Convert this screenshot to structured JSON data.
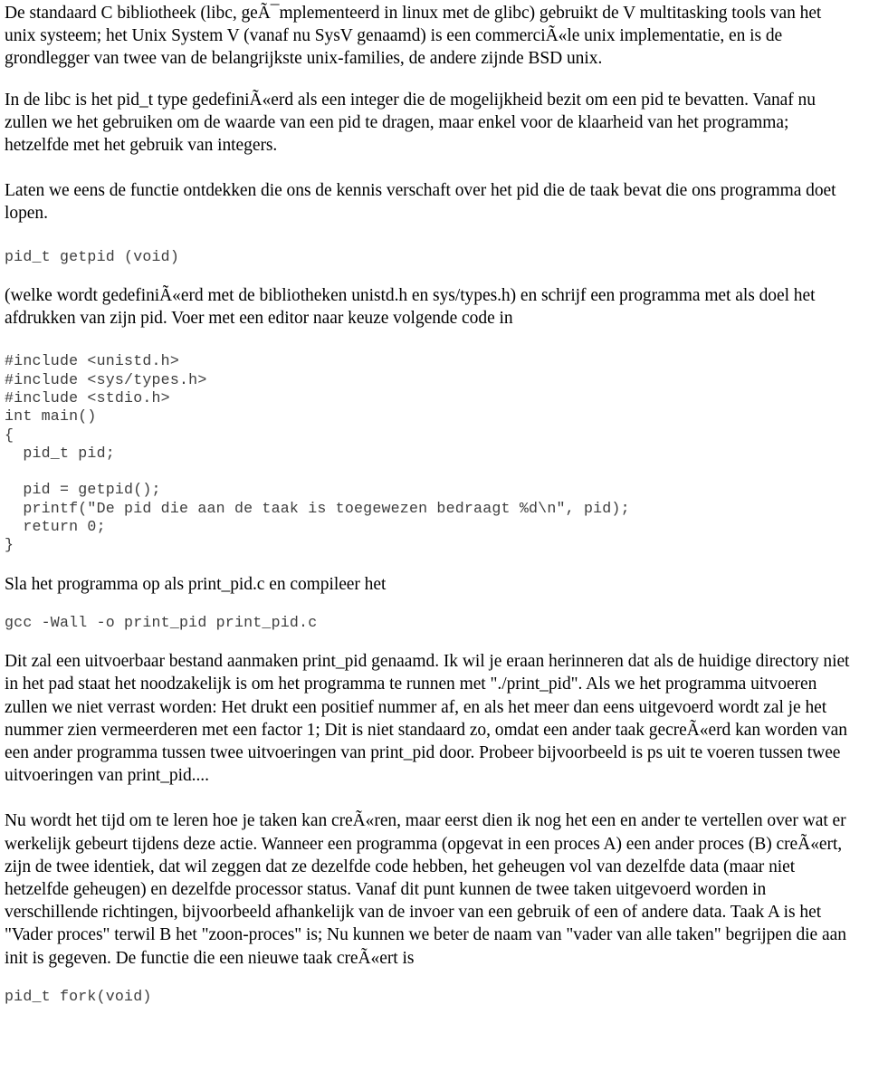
{
  "document": {
    "type": "text-document-page",
    "language": "nl",
    "colors": {
      "background": "#ffffff",
      "body_text": "#010101",
      "code_text": "#3d3d3d"
    },
    "blocks": [
      {
        "id": "para-1",
        "kind": "paragraph",
        "text": "De standaard C bibliotheek (libc, geÃ¯mplementeerd in linux met de glibc) gebruikt de V multitasking tools van het unix systeem; het Unix System V (vanaf nu SysV genaamd) is een commerciÃ«le unix implementatie, en is de grondlegger van twee van de belangrijkste unix-families, de andere zijnde BSD unix."
      },
      {
        "id": "para-2",
        "kind": "paragraph",
        "text": "In de libc is het pid_t type gedefiniÃ«erd als een integer die de mogelijkheid bezit om een pid te bevatten. Vanaf nu zullen we het gebruiken om de waarde van een pid te dragen, maar enkel voor de klaarheid van het programma; hetzelfde met het gebruik van integers."
      },
      {
        "id": "para-3",
        "kind": "paragraph",
        "text": "Laten we eens de functie ontdekken die ons de kennis verschaft over het pid die de taak bevat die ons programma doet lopen."
      },
      {
        "id": "code-1",
        "kind": "code-line",
        "text": "pid_t getpid (void)"
      },
      {
        "id": "para-4",
        "kind": "paragraph",
        "text": "(welke wordt gedefiniÃ«erd met de bibliotheken unistd.h en sys/types.h) en schrijf een programma met als doel het afdrukken van zijn pid. Voer met een editor naar keuze volgende code in"
      },
      {
        "id": "code-2",
        "kind": "code-block",
        "lines": [
          "#include <unistd.h>",
          "#include <sys/types.h>",
          "#include <stdio.h>",
          "int main()",
          "{",
          "  pid_t pid;",
          "",
          "  pid = getpid();",
          "  printf(\"De pid die aan de taak is toegewezen bedraagt %d\\n\", pid);",
          "  return 0;",
          "}"
        ]
      },
      {
        "id": "para-5",
        "kind": "paragraph",
        "text": "Sla het programma op als print_pid.c en compileer het"
      },
      {
        "id": "code-3",
        "kind": "code-line",
        "text": "gcc -Wall -o print_pid print_pid.c"
      },
      {
        "id": "para-6",
        "kind": "paragraph",
        "text": "Dit zal een uitvoerbaar bestand aanmaken print_pid genaamd. Ik wil je eraan herinneren dat als de huidige directory niet in het pad staat het noodzakelijk is om het programma te runnen met \"./print_pid\". Als we het programma uitvoeren zullen we niet verrast worden: Het drukt een positief nummer af, en als het meer dan eens uitgevoerd wordt zal je het nummer zien vermeerderen met een factor 1; Dit is niet standaard zo, omdat een ander taak gecreÃ«erd kan worden van een ander programma tussen twee uitvoeringen van print_pid door. Probeer bijvoorbeeld is ps uit te voeren tussen twee uitvoeringen van print_pid...."
      },
      {
        "id": "para-7",
        "kind": "paragraph",
        "text": "Nu wordt het tijd om te leren hoe je taken kan creÃ«ren, maar eerst dien ik nog het een en ander te vertellen over wat er werkelijk gebeurt tijdens deze actie. Wanneer een programma (opgevat in een proces A) een ander proces (B) creÃ«ert, zijn de twee identiek, dat wil zeggen dat ze dezelfde code hebben, het geheugen vol van dezelfde data (maar niet hetzelfde geheugen) en dezelfde processor status. Vanaf dit punt kunnen de twee taken uitgevoerd worden in verschillende richtingen, bijvoorbeeld afhankelijk van de invoer van een gebruik of een of andere data. Taak A is het \"Vader proces\" terwil B het \"zoon-proces\" is; Nu kunnen we beter de naam van \"vader van alle taken\" begrijpen die aan init is gegeven. De functie die een nieuwe taak creÃ«ert is"
      },
      {
        "id": "code-4",
        "kind": "code-line",
        "text": "pid_t fork(void)"
      }
    ]
  }
}
